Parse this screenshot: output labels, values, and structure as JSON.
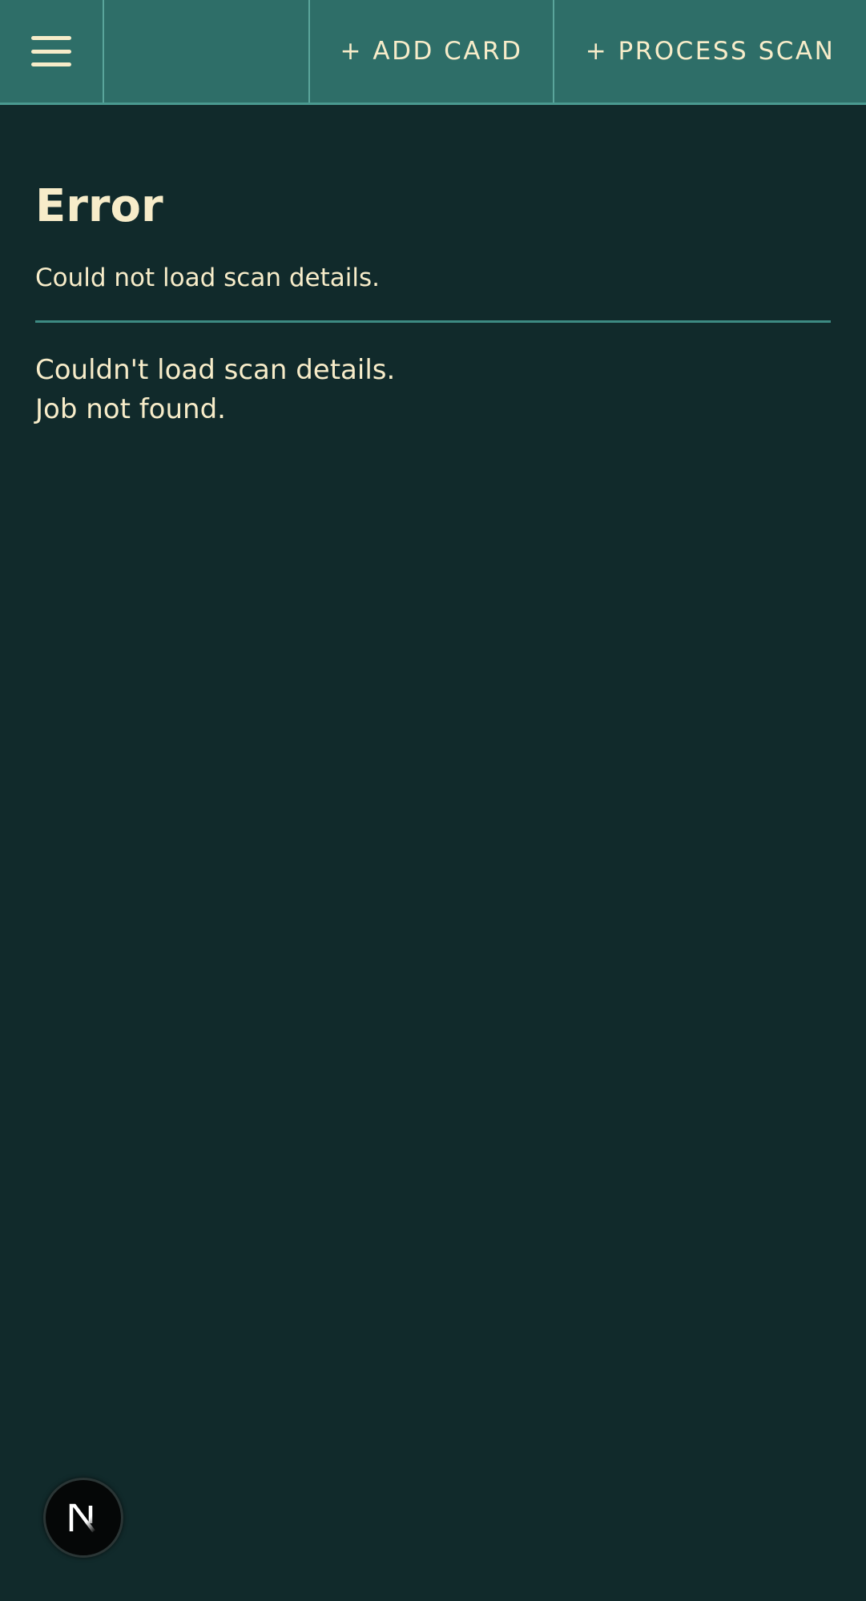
{
  "header": {
    "menu_icon": "hamburger-menu-icon",
    "add_card_label": "+ ADD CARD",
    "process_scan_label": "+ PROCESS SCAN"
  },
  "main": {
    "title": "Error",
    "subtitle": "Could not load scan details.",
    "message_line1": "Couldn't load scan details.",
    "message_line2": "Job not found."
  },
  "dev_badge": {
    "icon": "nextjs-logo-icon"
  },
  "colors": {
    "background": "#112a2b",
    "header": "#2e6e68",
    "text": "#f7ecc9",
    "divider": "#3d8a82"
  }
}
